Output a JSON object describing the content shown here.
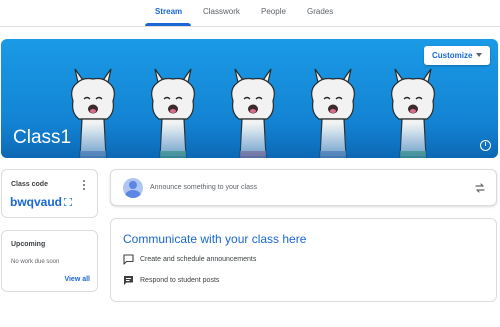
{
  "tabs": [
    {
      "label": "Stream",
      "active": true
    },
    {
      "label": "Classwork",
      "active": false
    },
    {
      "label": "People",
      "active": false
    },
    {
      "label": "Grades",
      "active": false
    }
  ],
  "banner": {
    "title": "Class1",
    "customize_label": "Customize",
    "info_icon": "info-icon"
  },
  "class_code": {
    "label": "Class code",
    "value": "bwqvaud"
  },
  "upcoming": {
    "title": "Upcoming",
    "empty_text": "No work due soon",
    "view_all": "View all"
  },
  "announce": {
    "placeholder": "Announce something to your class"
  },
  "communicate": {
    "title": "Communicate with your class here",
    "items": [
      {
        "icon": "chat-bubble-icon",
        "label": "Create and schedule announcements"
      },
      {
        "icon": "comment-icon",
        "label": "Respond to student posts"
      }
    ]
  },
  "colors": {
    "accent": "#1967d2",
    "banner": "#1487d6"
  }
}
